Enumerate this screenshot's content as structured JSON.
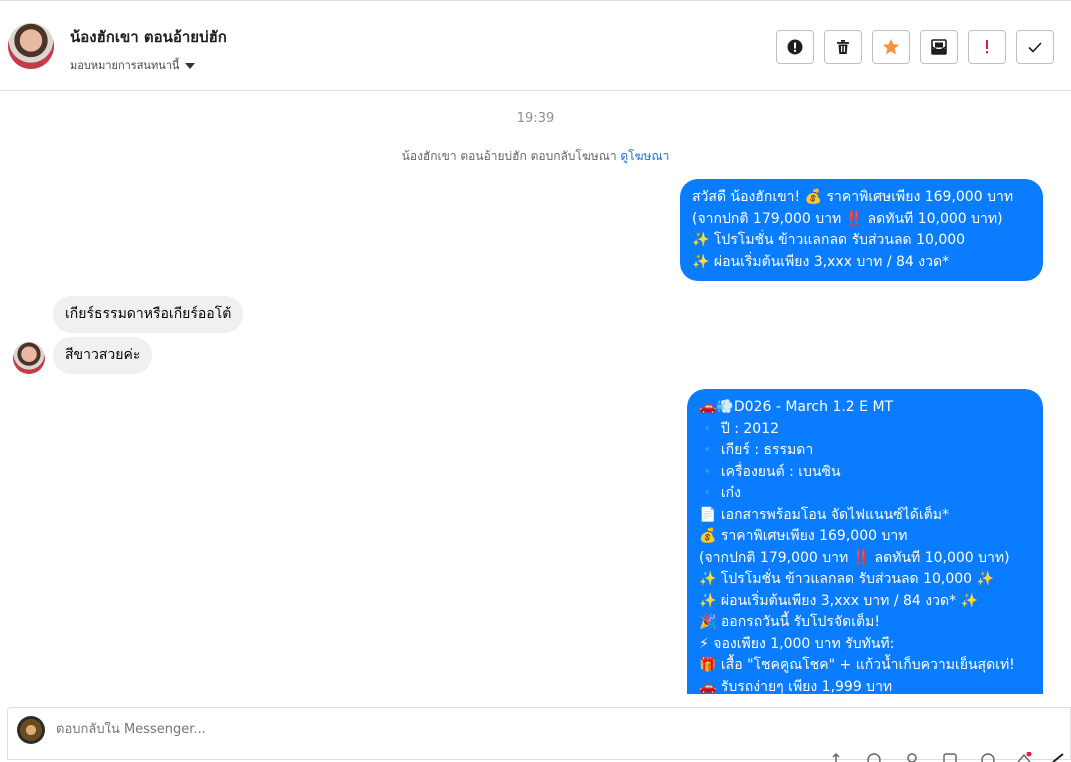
{
  "header": {
    "name": "น้องฮักเขา ตอนอ้ายบ่ฮัก",
    "assign_label": "มอบหมายการสนทนานี้",
    "buttons": [
      {
        "name": "report-button",
        "icon": "alert-circle-icon"
      },
      {
        "name": "delete-button",
        "icon": "trash-icon"
      },
      {
        "name": "star-button",
        "icon": "star-icon"
      },
      {
        "name": "mark-unread-button",
        "icon": "envelope-icon"
      },
      {
        "name": "spam-button",
        "icon": "exclamation-icon"
      },
      {
        "name": "done-button",
        "icon": "check-icon"
      }
    ]
  },
  "conversation": {
    "timestamp": "19:39",
    "ad_notice": "น้องฮักเขา ตอนอ้ายบ่ฮัก ตอบกลับโฆษณา",
    "ad_link": "ดูโฆษณา",
    "outgoing_1": [
      "สวัสดี น้องฮักเขา! 💰 ราคาพิเศษเพียง 169,000 บาท",
      "(จากปกติ 179,000 บาท ‼️ ลดทันที 10,000 บาท)",
      "✨ โปรโมชั่น ข้าวแลกลด รับส่วนลด 10,000",
      "✨ ผ่อนเริ่มต้นเพียง 3,xxx บาท / 84 งวด*"
    ],
    "incoming": [
      "เกียร์ธรรมดาหรือเกียร์ออโต้",
      "สีขาวสวยค่ะ"
    ],
    "outgoing_2": [
      "🚗💨D026 - March 1.2 E MT",
      "🔹 ปี : 2012",
      "🔹 เกียร์ : ธรรมดา",
      "🔹 เครื่องยนต์ : เบนซิน",
      "🔹 เก๋ง",
      "📄 เอกสารพร้อมโอน จัดไฟแนนซ์ได้เต็ม*",
      "💰 ราคาพิเศษเพียง 169,000 บาท",
      "(จากปกติ 179,000 บาท ‼️ ลดทันที 10,000 บาท)",
      "✨ โปรโมชั่น ข้าวแลกลด รับส่วนลด 10,000 ✨",
      "✨ ผ่อนเริ่มต้นเพียง 3,xxx บาท / 84 งวด* ✨",
      "🎉 ออกรถวันนี้ รับโปรจัดเต็ม!",
      "⚡ จองเพียง 1,000 บาท รับทันที:",
      "🎁 เสื้อ \"โชคคูณโชค\" + แก้วน้ำเก็บความเย็นสุดเท่!",
      "🚗 รับรถง่ายๆ เพียง 1,999 บาท"
    ]
  },
  "composer": {
    "placeholder": "ตอบกลับใน Messenger..."
  },
  "colors": {
    "outgoing_bubble": "#0a7cff",
    "incoming_bubble": "#f0f0f0",
    "star": "#f7923b",
    "spam": "#e41e3f"
  }
}
